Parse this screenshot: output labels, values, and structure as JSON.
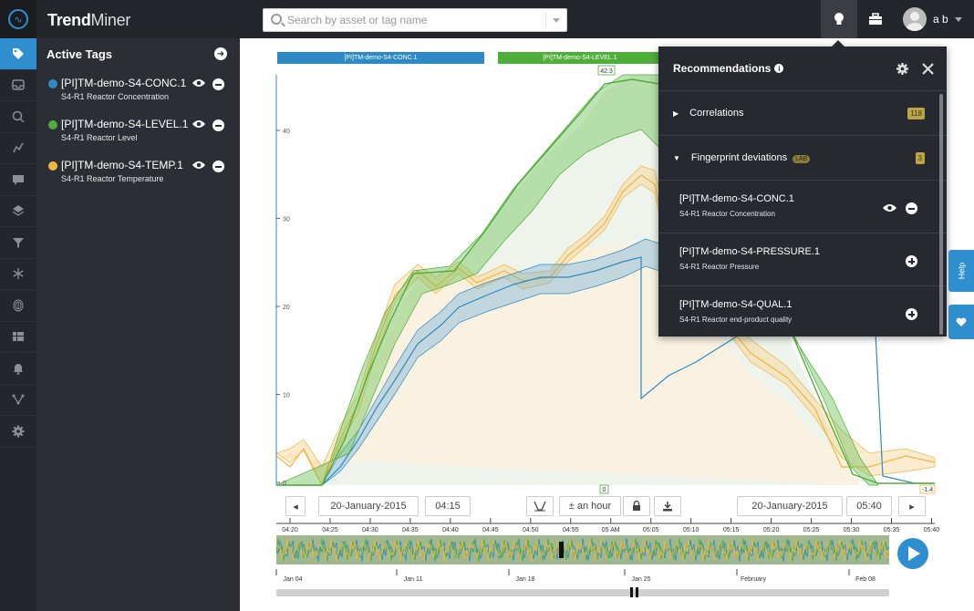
{
  "app": {
    "brand_bold": "Trend",
    "brand_light": "Miner",
    "search_placeholder": "Search by asset or tag name",
    "user_initials": "a b"
  },
  "sidebar": {
    "title": "Active Tags",
    "tags": [
      {
        "name": "[PI]TM-demo-S4-CONC.1",
        "desc": "S4-R1 Reactor Concentration",
        "color": "#2e8ac4"
      },
      {
        "name": "[PI]TM-demo-S4-LEVEL.1",
        "desc": "S4-R1 Reactor Level",
        "color": "#4fad3a"
      },
      {
        "name": "[PI]TM-demo-S4-TEMP.1",
        "desc": "S4-R1 Reactor Temperature",
        "color": "#f2b441"
      }
    ]
  },
  "chart": {
    "axis_tags": [
      "[PI]TM-demo-S4-CONC.1",
      "[PI]TM-demo-S4-LEVEL.1"
    ],
    "level_max_label": "42.3",
    "zero_label": "0",
    "right_label": "-1.4",
    "y_ticks": [
      "0",
      "10",
      "20",
      "30",
      "40"
    ],
    "time_ticks": [
      "04:20",
      "04:25",
      "04:30",
      "04:35",
      "04:40",
      "04:45",
      "04:50",
      "04:55",
      "05 AM",
      "05:05",
      "05:10",
      "05:15",
      "05:20",
      "05:25",
      "05:30",
      "05:35",
      "05:40"
    ],
    "overview_ticks": [
      "Jan 04",
      "Jan 11",
      "Jan 18",
      "Jan 25",
      "February",
      "Feb 08"
    ]
  },
  "controls": {
    "start_date": "20-January-2015",
    "start_time": "04:15",
    "range": "± an hour",
    "end_date": "20-January-2015",
    "end_time": "05:40"
  },
  "recommendations": {
    "title": "Recommendations",
    "correlations_label": "Correlations",
    "correlations_count": "118",
    "fingerprint_label": "Fingerprint deviations",
    "lab_badge": "LAB",
    "fingerprint_count": "3",
    "items": [
      {
        "name": "[PI]TM-demo-S4-CONC.1",
        "desc": "S4-R1 Reactor Concentration"
      },
      {
        "name": "[PI]TM-demo-S4-PRESSURE.1",
        "desc": "S4-R1 Reactor Pressure"
      },
      {
        "name": "[PI]TM-demo-S4-QUAL.1",
        "desc": "S4-R1 Reactor end-product quality"
      }
    ]
  },
  "side_tabs": {
    "help": "Help"
  }
}
